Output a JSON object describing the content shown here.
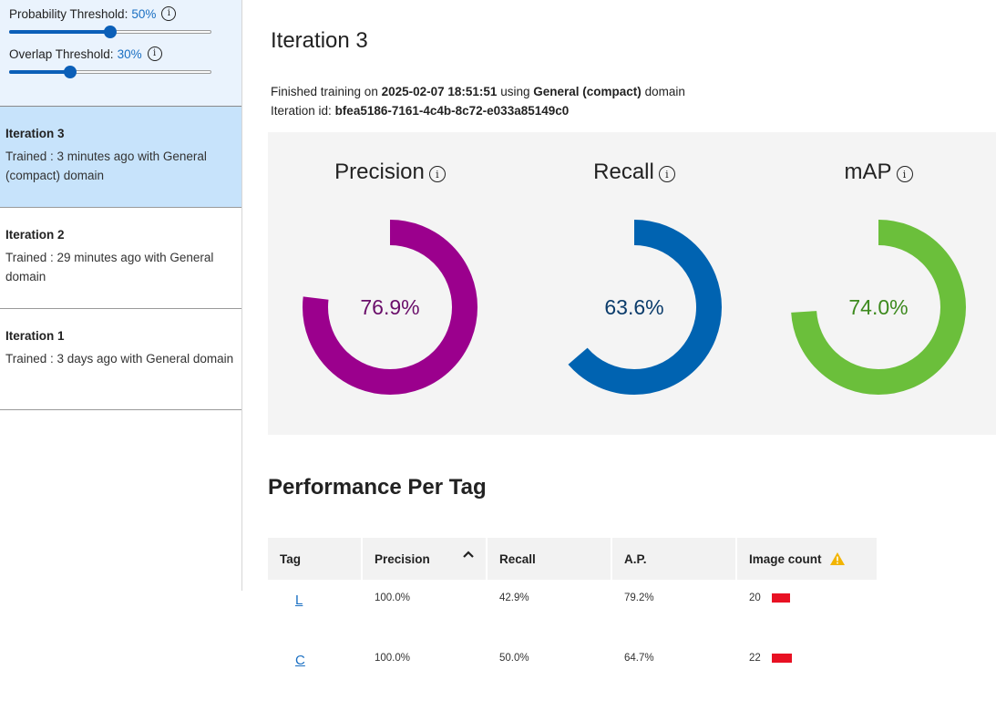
{
  "sidebar": {
    "probability": {
      "label": "Probability Threshold:",
      "value": "50%",
      "level": 0.5
    },
    "overlap": {
      "label": "Overlap Threshold:",
      "value": "30%",
      "level": 0.3
    },
    "iterations": [
      {
        "name": "Iteration 3",
        "desc": "Trained : 3 minutes ago with General (compact) domain",
        "active": true
      },
      {
        "name": "Iteration 2",
        "desc": "Trained : 29 minutes ago with General domain",
        "active": false
      },
      {
        "name": "Iteration 1",
        "desc": "Trained : 3 days ago with General domain",
        "active": false
      }
    ]
  },
  "main": {
    "title": "Iteration 3",
    "meta": {
      "finished_prefix": "Finished training on",
      "finished_date": "2025-02-07 18:51:51",
      "using": "using",
      "domain": "General (compact)",
      "domain_suffix": "domain",
      "id_label": "Iteration id:",
      "id_value": "bfea5186-7161-4c4b-8c72-e033a85149c0"
    },
    "metrics": [
      {
        "name": "Precision",
        "value": "76.9%",
        "fraction": 0.769,
        "color": "#9b008d",
        "text_color": "#6a0e6a"
      },
      {
        "name": "Recall",
        "value": "63.6%",
        "fraction": 0.636,
        "color": "#0063b1",
        "text_color": "#0b3c6b"
      },
      {
        "name": "mAP",
        "value": "74.0%",
        "fraction": 0.74,
        "color": "#6bbf3b",
        "text_color": "#3d8a1e"
      }
    ],
    "section_title": "Performance Per Tag",
    "table": {
      "headers": [
        "Tag",
        "Precision",
        "Recall",
        "A.P.",
        "Image count"
      ],
      "rows": [
        {
          "tag": "L",
          "precision": "100.0%",
          "recall": "42.9%",
          "ap": "79.2%",
          "count": "20"
        },
        {
          "tag": "C",
          "precision": "100.0%",
          "recall": "50.0%",
          "ap": "64.7%",
          "count": "22"
        }
      ]
    }
  }
}
